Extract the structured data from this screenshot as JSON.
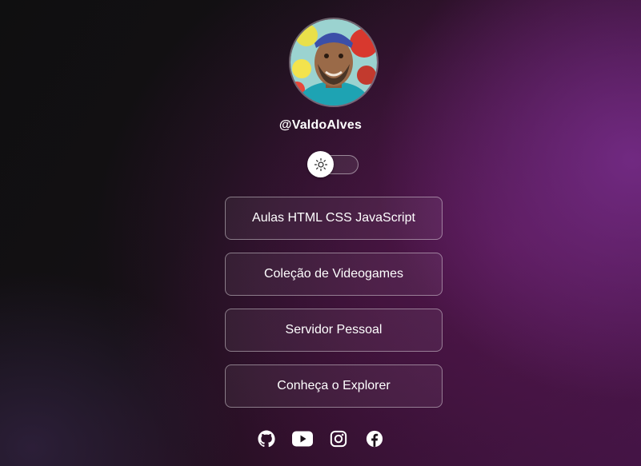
{
  "profile": {
    "handle": "@ValdoAlves"
  },
  "theme_toggle": {
    "state": "light",
    "icon": "sun-icon"
  },
  "links": [
    {
      "label": "Aulas HTML CSS JavaScript"
    },
    {
      "label": "Coleção de Videogames"
    },
    {
      "label": "Servidor Pessoal"
    },
    {
      "label": "Conheça o Explorer"
    }
  ],
  "socials": [
    {
      "icon": "github-icon"
    },
    {
      "icon": "youtube-icon"
    },
    {
      "icon": "instagram-icon"
    },
    {
      "icon": "facebook-icon"
    }
  ],
  "colors": {
    "accent": "#5a1f5e",
    "text": "#ffffff",
    "background": "#120d12"
  }
}
